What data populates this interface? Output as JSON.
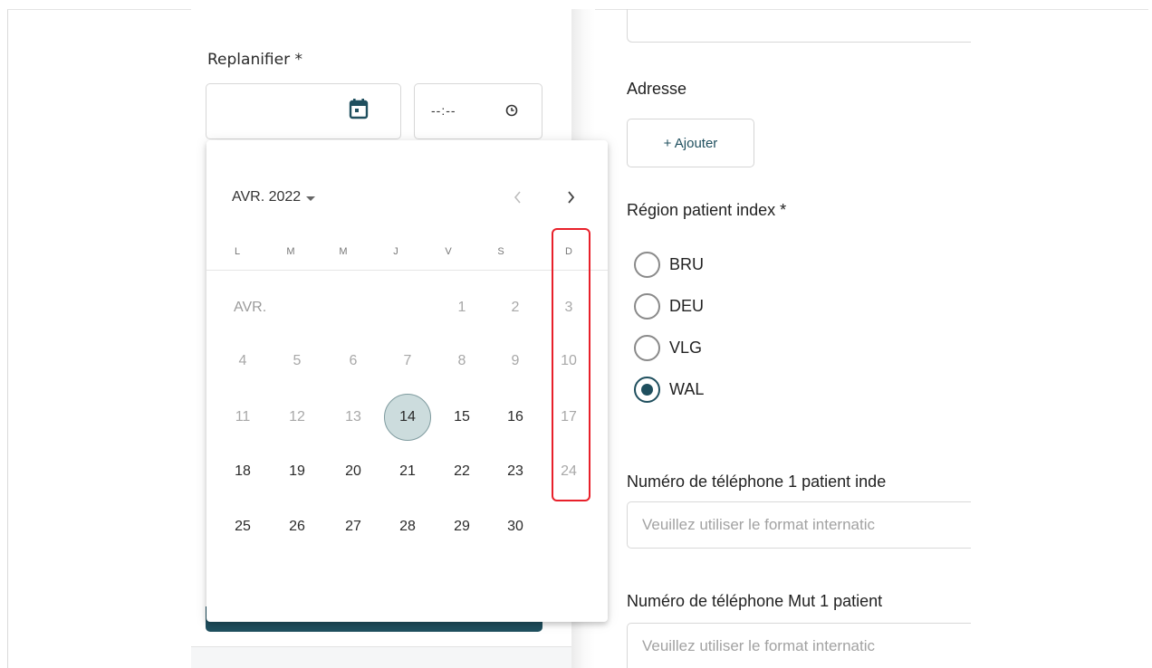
{
  "reschedule": {
    "label": "Replanifier *",
    "time_value": "--:--"
  },
  "calendar": {
    "month_year": "AVR. 2022",
    "month_short": "AVR.",
    "weekdays": [
      "L",
      "M",
      "M",
      "J",
      "V",
      "S",
      "D"
    ],
    "selected_day": "14",
    "weeks": [
      [
        "",
        "",
        "",
        "",
        "1",
        "2",
        "3"
      ],
      [
        "4",
        "5",
        "6",
        "7",
        "8",
        "9",
        "10"
      ],
      [
        "11",
        "12",
        "13",
        "14",
        "15",
        "16",
        "17"
      ],
      [
        "18",
        "19",
        "20",
        "21",
        "22",
        "23",
        "24"
      ],
      [
        "25",
        "26",
        "27",
        "28",
        "29",
        "30",
        ""
      ]
    ]
  },
  "address": {
    "label": "Adresse",
    "add_button": "+ Ajouter"
  },
  "region": {
    "label": "Région patient index *",
    "options": [
      "BRU",
      "DEU",
      "VLG",
      "WAL"
    ],
    "selected": "WAL"
  },
  "phone1": {
    "label": "Numéro de téléphone 1 patient inde",
    "placeholder": "Veuillez utiliser le format internatic"
  },
  "phone_mut1": {
    "label": "Numéro de téléphone Mut 1 patient",
    "placeholder": "Veuillez utiliser le format internatic"
  },
  "colors": {
    "accent": "#1f4f5e",
    "selected_day_bg": "#ccdcdd",
    "highlight_box": "#e8202a"
  }
}
